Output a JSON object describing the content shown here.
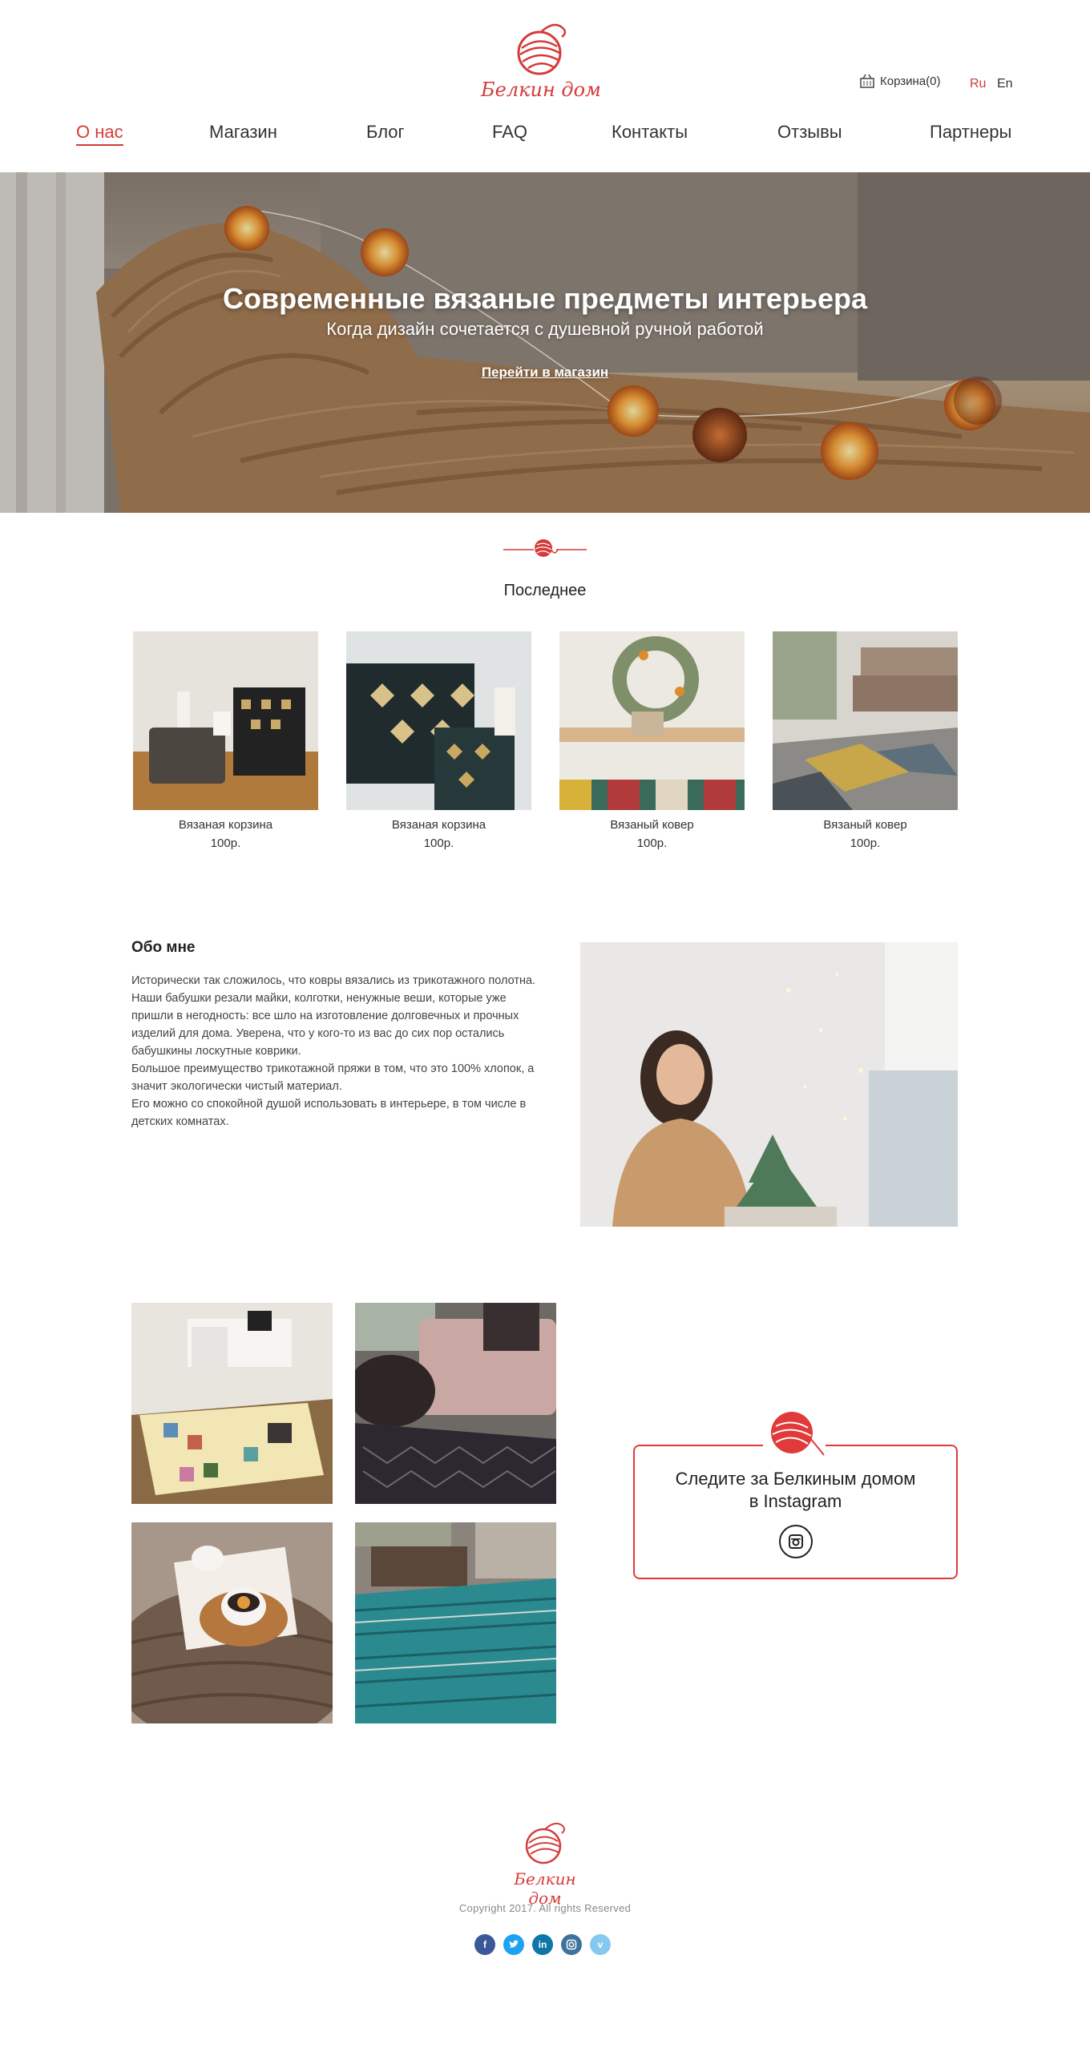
{
  "header": {
    "logo_text": "Белкин дом",
    "cart_label": "Корзина(0)",
    "lang_ru": "Ru",
    "lang_en": "En",
    "nav": [
      {
        "label": "О нас",
        "active": true
      },
      {
        "label": "Магазин"
      },
      {
        "label": "Блог"
      },
      {
        "label": "FAQ"
      },
      {
        "label": "Контакты"
      },
      {
        "label": "Отзывы"
      },
      {
        "label": "Партнеры"
      }
    ]
  },
  "hero": {
    "title": "Современные вязаные предметы интерьера",
    "subtitle": "Когда дизайн сочетается с душевной ручной работой",
    "cta": "Перейти в магазин"
  },
  "latest": {
    "title": "Последнее",
    "items": [
      {
        "name": "Вязаная корзина",
        "price": "100р."
      },
      {
        "name": "Вязаная корзина",
        "price": "100р."
      },
      {
        "name": "Вязаный ковер",
        "price": "100р."
      },
      {
        "name": "Вязаный ковер",
        "price": "100р."
      }
    ]
  },
  "about": {
    "title": "Обо мне",
    "paragraphs": [
      "Исторически так сложилось, что ковры вязались из трикотажного полотна. Наши бабушки резали майки, колготки, ненужные веши, которые уже пришли в негодность: все шло на изготовление долговечных и прочных изделий для дома. Уверена, что у кого-то из вас до сих пор остались бабушкины лоскутные коврики.",
      "Большое преимущество трикотажной пряжи в том, что это 100% хлопок, а значит экологически чистый материал.",
      "Его можно со спокойной душой использовать в интерьере, в том числе в детских комнатах."
    ]
  },
  "instagram": {
    "line1": "Следите за Белкиным домом",
    "line2": "в Instagram"
  },
  "footer": {
    "logo_text": "Белкин дом",
    "copyright": "Copyright 2017. All rights Reserved",
    "socials": [
      "facebook-icon",
      "twitter-icon",
      "linkedin-icon",
      "instagram-icon",
      "vimeo-icon"
    ]
  },
  "colors": {
    "accent": "#d63a3a"
  }
}
